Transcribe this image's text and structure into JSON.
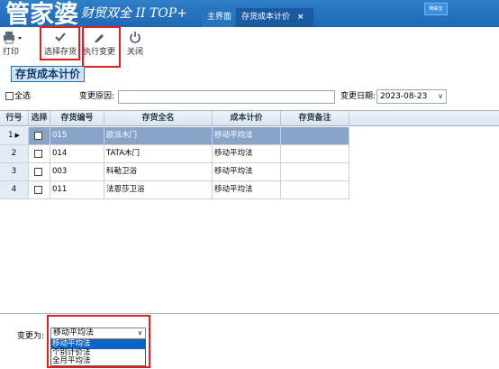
{
  "header": {
    "brand": "管家婆",
    "brand_sub": "财贸双全 II TOP+",
    "tabs": [
      {
        "label": "主界面"
      },
      {
        "label": "存货成本计价",
        "close": "×"
      }
    ],
    "badge": "畅联宝"
  },
  "toolbar": {
    "print_label": "打印",
    "select_label": "选择存货",
    "exec_label": "执行变更",
    "close_label": "关闭"
  },
  "icons": {
    "print": "printer-icon",
    "select": "check-icon",
    "exec": "pencil-icon",
    "close": "power-icon"
  },
  "title": "存货成本计价",
  "filter": {
    "select_all": "全选",
    "reason_label": "变更原因:",
    "reason_value": "",
    "date_label": "变更日期:",
    "date_value": "2023-08-23"
  },
  "grid": {
    "columns": [
      "行号",
      "选择",
      "存货编号",
      "存货全名",
      "成本计价",
      "存货备注"
    ],
    "rows": [
      {
        "num": "1",
        "code": "015",
        "name": "欧派木门",
        "method": "移动平均法",
        "note": ""
      },
      {
        "num": "2",
        "code": "014",
        "name": "TATA木门",
        "method": "移动平均法",
        "note": ""
      },
      {
        "num": "3",
        "code": "003",
        "name": "科勒卫浴",
        "method": "移动平均法",
        "note": ""
      },
      {
        "num": "4",
        "code": "011",
        "name": "法恩莎卫浴",
        "method": "移动平均法",
        "note": ""
      }
    ]
  },
  "bottom": {
    "change_label": "变更为:",
    "selected": "移动平均法",
    "options": [
      "移动平均法",
      "个别计价法",
      "全月平均法"
    ]
  },
  "colors": {
    "header_blue": "#1f67b4",
    "highlight_red": "#e02020",
    "selected_row": "#8aa4c8",
    "dropdown_highlight": "#0a64c8"
  }
}
